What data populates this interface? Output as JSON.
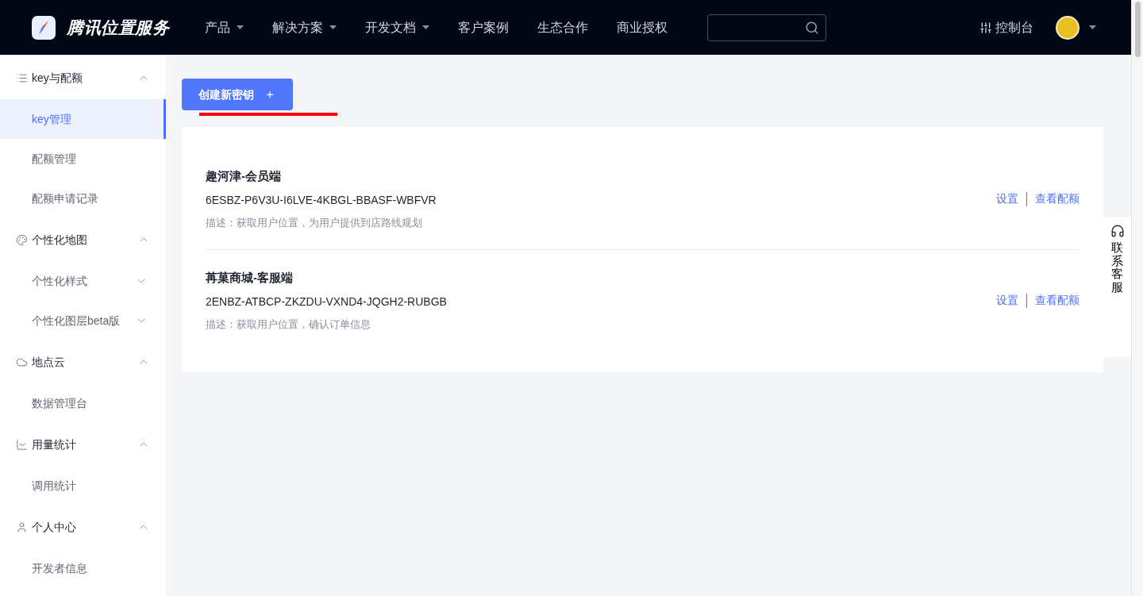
{
  "header": {
    "brand": "腾讯位置服务",
    "nav": [
      {
        "label": "产品",
        "dropdown": true
      },
      {
        "label": "解决方案",
        "dropdown": true
      },
      {
        "label": "开发文档",
        "dropdown": true
      },
      {
        "label": "客户案例",
        "dropdown": false
      },
      {
        "label": "生态合作",
        "dropdown": false
      },
      {
        "label": "商业授权",
        "dropdown": false
      }
    ],
    "console": "控制台"
  },
  "sidebar": {
    "groups": [
      {
        "label": "key与配额",
        "expanded": true,
        "children": [
          {
            "label": "key管理",
            "selected": true
          },
          {
            "label": "配额管理",
            "selected": false
          },
          {
            "label": "配额申请记录",
            "selected": false
          }
        ]
      },
      {
        "label": "个性化地图",
        "expanded": true,
        "children": [
          {
            "label": "个性化样式",
            "selected": false,
            "expanded": false
          },
          {
            "label": "个性化图层beta版",
            "selected": false,
            "expanded": false
          }
        ]
      },
      {
        "label": "地点云",
        "expanded": true,
        "children": [
          {
            "label": "数据管理台",
            "selected": false
          }
        ]
      },
      {
        "label": "用量统计",
        "expanded": true,
        "children": [
          {
            "label": "调用统计",
            "selected": false
          }
        ]
      },
      {
        "label": "个人中心",
        "expanded": true,
        "children": [
          {
            "label": "开发者信息",
            "selected": false
          }
        ]
      }
    ]
  },
  "create_button": "创建新密钥",
  "create_button_icon": "＋",
  "keys": [
    {
      "name": "趣河津-会员端",
      "key": "6ESBZ-P6V3U-I6LVE-4KBGL-BBASF-WBFVR",
      "description": "描述：获取用户位置，为用户提供到店路线规划",
      "actions": [
        "设置",
        "查看配额"
      ]
    },
    {
      "name": "苒菓商城-客服端",
      "key": "2ENBZ-ATBCP-ZKZDU-VXND4-JQGH2-RUBGB",
      "description": "描述：获取用户位置，确认订单信息",
      "actions": [
        "设置",
        "查看配额"
      ]
    }
  ],
  "support_tab": "联系客服"
}
